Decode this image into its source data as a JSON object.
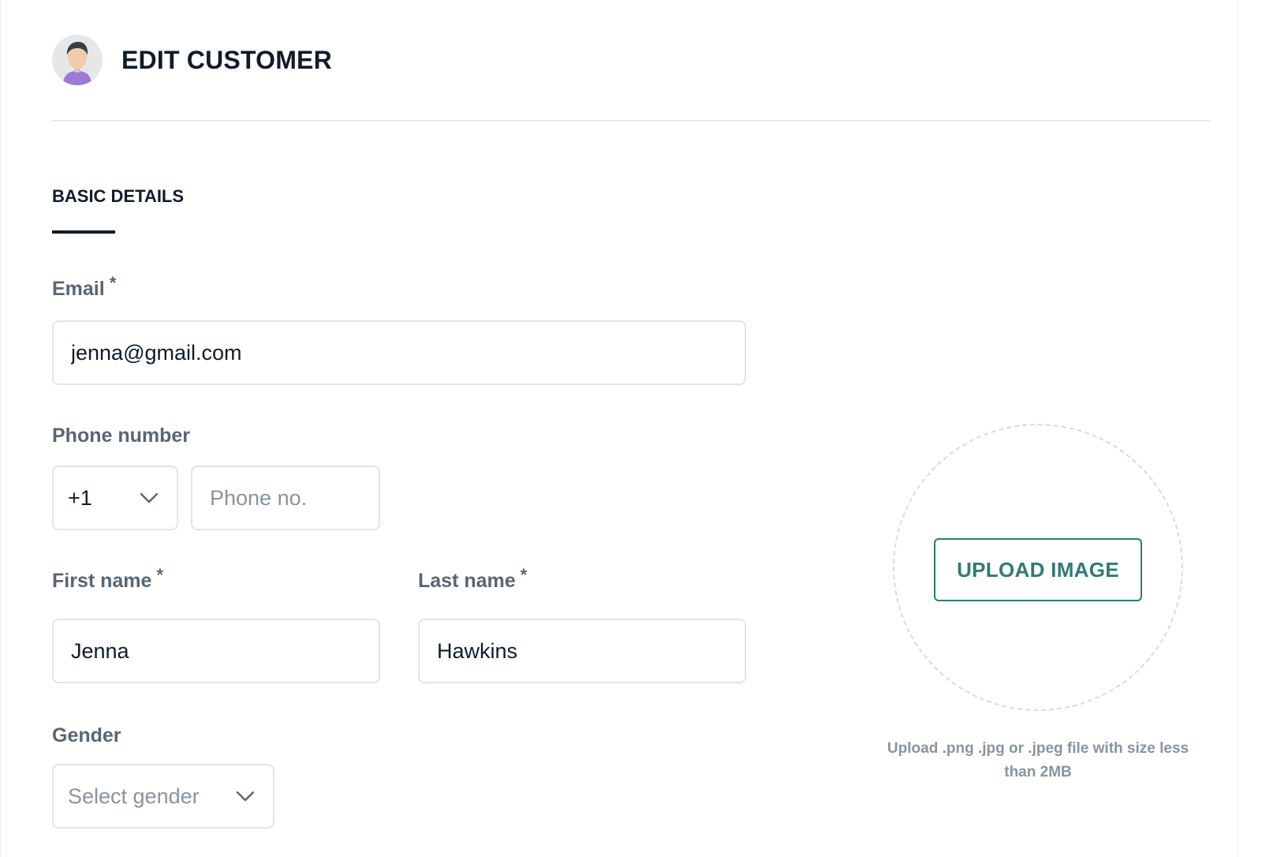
{
  "header": {
    "title": "EDIT CUSTOMER",
    "avatar_icon": "user-avatar-icon"
  },
  "section": {
    "tab_label": "BASIC DETAILS"
  },
  "form": {
    "email": {
      "label": "Email",
      "required_mark": "*",
      "value": "jenna@gmail.com"
    },
    "phone": {
      "label": "Phone number",
      "country_code": "+1",
      "placeholder": "Phone no."
    },
    "first_name": {
      "label": "First name",
      "required_mark": "*",
      "value": "Jenna"
    },
    "last_name": {
      "label": "Last name",
      "required_mark": "*",
      "value": "Hawkins"
    },
    "gender": {
      "label": "Gender",
      "placeholder": "Select gender"
    }
  },
  "upload": {
    "button_label": "UPLOAD IMAGE",
    "hint": "Upload .png .jpg or .jpeg file with size less than 2MB"
  },
  "colors": {
    "accent": "#2f7b73",
    "title": "#111b29",
    "label": "#5a6573",
    "muted": "#8a939e",
    "border": "#e1e4e8"
  }
}
